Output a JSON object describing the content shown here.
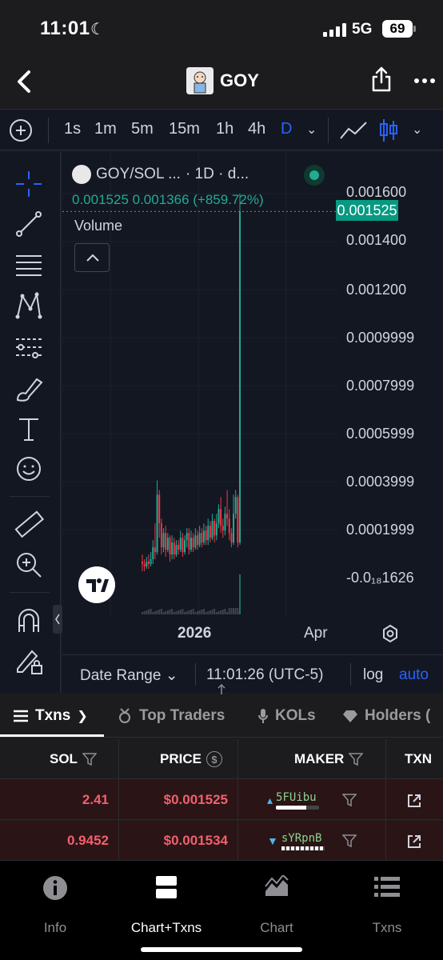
{
  "status_bar": {
    "time": "11:01",
    "network": "5G",
    "battery": "69"
  },
  "header": {
    "token_name": "GOY"
  },
  "timeframes": [
    "1s",
    "1m",
    "5m",
    "15m",
    "1h",
    "4h",
    "D"
  ],
  "active_timeframe": "D",
  "chart": {
    "symbol": "GOY/SOL ...",
    "interval": "· 1D · d...",
    "ohlc_line": "0.001525  0.001366 (+859.72%)",
    "volume_label": "Volume",
    "current_price": "0.001525",
    "y_ticks": [
      "0.001600",
      "0.001400",
      "0.001200",
      "0.0009999",
      "0.0007999",
      "0.0005999",
      "0.0003999",
      "0.0001999",
      "-0.0₁₈1626"
    ],
    "x_ticks": [
      "2026",
      "Apr"
    ],
    "footer": {
      "date_range": "Date Range",
      "time_zone": "11:01:26 (UTC-5)",
      "log": "log",
      "auto": "auto"
    },
    "accent_up": "#22ab94",
    "accent_down": "#f23645"
  },
  "chart_data": {
    "type": "candlestick",
    "title": "GOY/SOL",
    "interval": "1D",
    "y_range": [
      0,
      0.0016
    ],
    "last_close": 0.001525,
    "change_pct": 859.72,
    "series": [
      {
        "o": 6e-05,
        "c": 5e-05,
        "h": 9e-05,
        "l": 2e-05
      },
      {
        "o": 5e-05,
        "c": 4e-05,
        "h": 7e-05,
        "l": 2e-05
      },
      {
        "o": 4e-05,
        "c": 6e-05,
        "h": 8e-05,
        "l": 3e-05
      },
      {
        "o": 6e-05,
        "c": 5e-05,
        "h": 9e-05,
        "l": 3e-05
      },
      {
        "o": 5e-05,
        "c": 7e-05,
        "h": 0.0001,
        "l": 4e-05
      },
      {
        "o": 7e-05,
        "c": 0.00012,
        "h": 0.00015,
        "l": 5e-05
      },
      {
        "o": 0.00012,
        "c": 0.0001,
        "h": 0.00022,
        "l": 7e-05
      },
      {
        "o": 0.0001,
        "c": 0.00034,
        "h": 0.0004,
        "l": 9e-05
      },
      {
        "o": 0.00034,
        "c": 0.00022,
        "h": 0.00036,
        "l": 0.00016
      },
      {
        "o": 0.00022,
        "c": 0.00012,
        "h": 0.00024,
        "l": 9e-05
      },
      {
        "o": 0.00012,
        "c": 0.00018,
        "h": 0.0002,
        "l": 0.0001
      },
      {
        "o": 0.00018,
        "c": 0.00011,
        "h": 0.00021,
        "l": 8e-05
      },
      {
        "o": 0.00011,
        "c": 0.00016,
        "h": 0.00018,
        "l": 0.0001
      },
      {
        "o": 0.00016,
        "c": 9e-05,
        "h": 0.00017,
        "l": 6e-05
      },
      {
        "o": 9e-05,
        "c": 0.00014,
        "h": 0.00017,
        "l": 7e-05
      },
      {
        "o": 0.00014,
        "c": 9e-05,
        "h": 0.00016,
        "l": 7e-05
      },
      {
        "o": 9e-05,
        "c": 0.00013,
        "h": 0.00015,
        "l": 8e-05
      },
      {
        "o": 0.00013,
        "c": 0.00011,
        "h": 0.00015,
        "l": 9e-05
      },
      {
        "o": 0.00011,
        "c": 0.00016,
        "h": 0.00019,
        "l": 0.0001
      },
      {
        "o": 0.00016,
        "c": 0.0001,
        "h": 0.00018,
        "l": 8e-05
      },
      {
        "o": 0.0001,
        "c": 0.00015,
        "h": 0.00017,
        "l": 9e-05
      },
      {
        "o": 0.00015,
        "c": 0.00018,
        "h": 0.0002,
        "l": 0.00012
      },
      {
        "o": 0.00018,
        "c": 0.00011,
        "h": 0.0002,
        "l": 9e-05
      },
      {
        "o": 0.00011,
        "c": 0.00016,
        "h": 0.00019,
        "l": 0.0001
      },
      {
        "o": 0.00016,
        "c": 0.00012,
        "h": 0.00018,
        "l": 0.0001
      },
      {
        "o": 0.00012,
        "c": 0.00017,
        "h": 0.0002,
        "l": 0.00011
      },
      {
        "o": 0.00017,
        "c": 0.00013,
        "h": 0.00019,
        "l": 0.00011
      },
      {
        "o": 0.00013,
        "c": 0.00018,
        "h": 0.00021,
        "l": 0.00012
      },
      {
        "o": 0.00018,
        "c": 0.00014,
        "h": 0.0002,
        "l": 0.00012
      },
      {
        "o": 0.00014,
        "c": 0.00019,
        "h": 0.00022,
        "l": 0.00013
      },
      {
        "o": 0.00019,
        "c": 0.00015,
        "h": 0.00021,
        "l": 0.00013
      },
      {
        "o": 0.00015,
        "c": 0.00021,
        "h": 0.00024,
        "l": 0.00013
      },
      {
        "o": 0.00021,
        "c": 0.00016,
        "h": 0.00023,
        "l": 0.00014
      },
      {
        "o": 0.00016,
        "c": 0.00023,
        "h": 0.00026,
        "l": 0.00015
      },
      {
        "o": 0.00023,
        "c": 0.00017,
        "h": 0.00024,
        "l": 0.00014
      },
      {
        "o": 0.00017,
        "c": 0.00022,
        "h": 0.00026,
        "l": 0.00015
      },
      {
        "o": 0.00022,
        "c": 0.00028,
        "h": 0.0003,
        "l": 0.0002
      },
      {
        "o": 0.00028,
        "c": 0.00021,
        "h": 0.00033,
        "l": 0.00018
      },
      {
        "o": 0.00021,
        "c": 0.00019,
        "h": 0.00024,
        "l": 0.00016
      },
      {
        "o": 0.00019,
        "c": 0.00026,
        "h": 0.00029,
        "l": 0.00017
      },
      {
        "o": 0.00026,
        "c": 0.00024,
        "h": 0.00036,
        "l": 0.00021
      },
      {
        "o": 0.00024,
        "c": 0.00018,
        "h": 0.00028,
        "l": 0.00015
      },
      {
        "o": 0.00018,
        "c": 0.00014,
        "h": 0.0002,
        "l": 0.00012
      },
      {
        "o": 0.00014,
        "c": 0.00026,
        "h": 0.00034,
        "l": 0.00013
      },
      {
        "o": 0.00026,
        "c": 0.00033,
        "h": 0.00036,
        "l": 0.00024
      },
      {
        "o": 0.00033,
        "c": 0.00014,
        "h": 0.00034,
        "l": 0.00012
      },
      {
        "o": 0.00014,
        "c": 0.001525,
        "h": 0.0016,
        "l": 0.00013
      }
    ]
  },
  "tabs": [
    {
      "label": "Txns",
      "active": true
    },
    {
      "label": "Top Traders",
      "active": false
    },
    {
      "label": "KOLs",
      "active": false
    },
    {
      "label": "Holders (",
      "active": false
    }
  ],
  "table": {
    "headers": [
      "SOL",
      "PRICE",
      "MAKER",
      "TXN"
    ],
    "rows": [
      {
        "sol": "2.41",
        "price": "$0.001525",
        "maker": "5FUibu"
      },
      {
        "sol": "0.9452",
        "price": "$0.001534",
        "maker": "sYRpnB"
      }
    ]
  },
  "bottom_nav": [
    {
      "label": "Info",
      "icon": "info-icon"
    },
    {
      "label": "Chart+Txns",
      "icon": "chart-txns-icon",
      "active": true
    },
    {
      "label": "Chart",
      "icon": "area-chart-icon"
    },
    {
      "label": "Txns",
      "icon": "list-icon"
    }
  ]
}
